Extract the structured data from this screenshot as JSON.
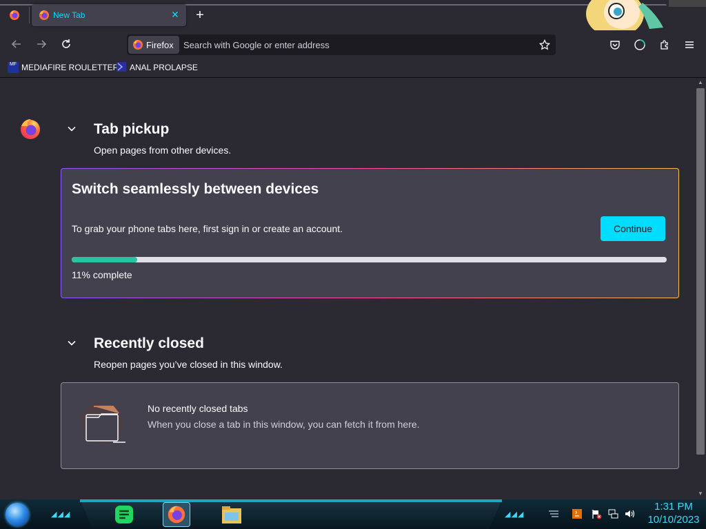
{
  "browser": {
    "tab": {
      "title": "New Tab",
      "close_icon": "close-icon"
    },
    "urlbar": {
      "identity_label": "Firefox",
      "placeholder": "Search with Google or enter address"
    },
    "bookmarks": [
      {
        "label": "MEDIAFIRE ROULETTER",
        "icon_text": "MF"
      },
      {
        "label": "ANAL PROLAPSE"
      }
    ]
  },
  "tab_pickup": {
    "title": "Tab pickup",
    "subtitle": "Open pages from other devices.",
    "card": {
      "title": "Switch seamlessly between devices",
      "text": "To grab your phone tabs here, first sign in or create an account.",
      "button": "Continue",
      "progress_percent": 11,
      "progress_label": "11% complete"
    }
  },
  "recently_closed": {
    "title": "Recently closed",
    "subtitle": "Reopen pages you’ve closed in this window.",
    "empty_title": "No recently closed tabs",
    "empty_text": "When you close a tab in this window, you can fetch it from here."
  },
  "taskbar": {
    "time": "1:31 PM",
    "date": "10/10/2023",
    "dash": "◢◢◢"
  },
  "colors": {
    "accent": "#00ddff",
    "progress": "#2ac3a2",
    "card": "#42414d",
    "page": "#2b2a33"
  }
}
